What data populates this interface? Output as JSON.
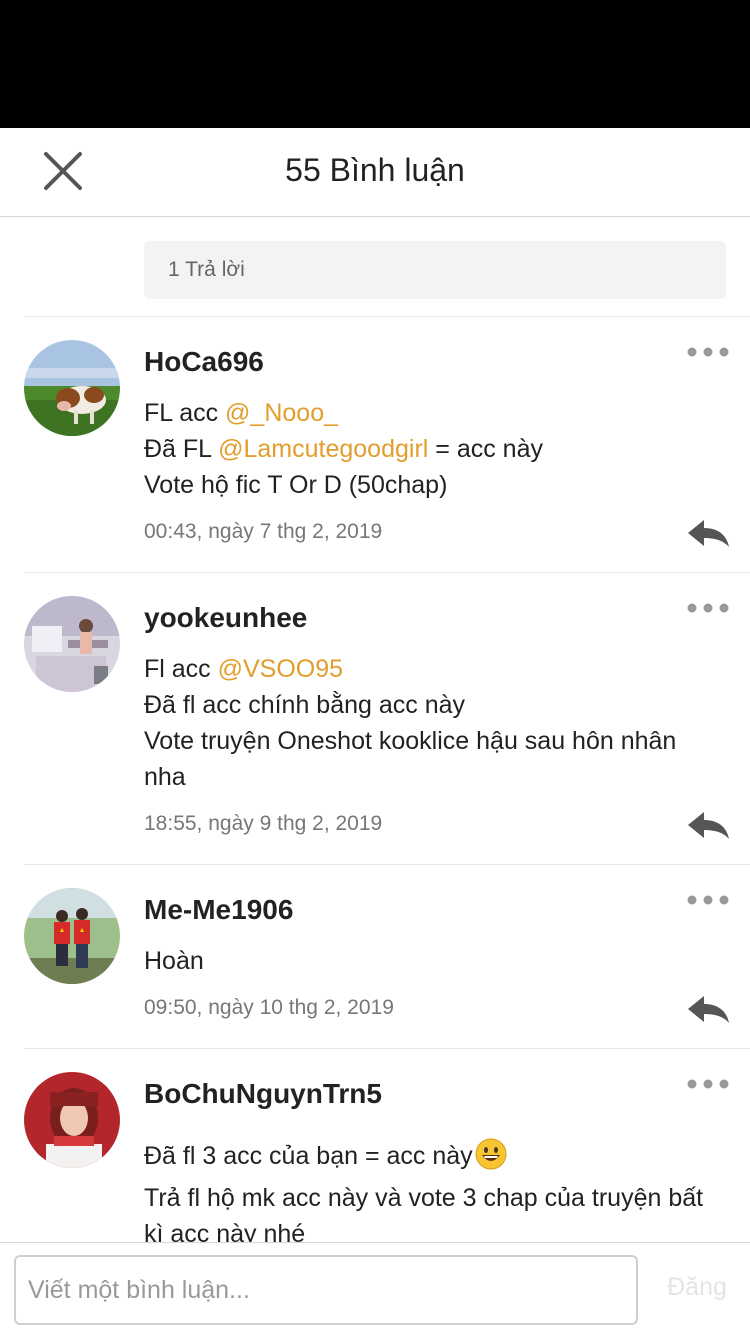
{
  "header": {
    "title": "55 Bình luận"
  },
  "reply_summary": "1 Trả lời",
  "accent_color": "#e29e2c",
  "comments": [
    {
      "username": "HoCa696",
      "avatar": "cow-in-field",
      "lines": [
        [
          {
            "text": "FL acc "
          },
          {
            "text": "@_Nooo_",
            "mention": true
          }
        ],
        [
          {
            "text": "Đã FL "
          },
          {
            "text": "@Lamcutegoodgirl",
            "mention": true
          },
          {
            "text": " = acc này"
          }
        ],
        [
          {
            "text": "Vote hộ fic T Or D (50chap)"
          }
        ]
      ],
      "timestamp": "00:43, ngày 7 thg 2, 2019"
    },
    {
      "username": "yookeunhee",
      "avatar": "room-interior",
      "lines": [
        [
          {
            "text": "Fl acc "
          },
          {
            "text": "@VSOO95",
            "mention": true
          }
        ],
        [
          {
            "text": "Đã fl acc chính bằng acc này"
          }
        ],
        [
          {
            "text": "Vote truyện Oneshot kooklice hậu sau hôn nhân"
          }
        ],
        [
          {
            "text": "nha"
          }
        ]
      ],
      "timestamp": "18:55, ngày 9 thg 2, 2019"
    },
    {
      "username": "Me-Me1906",
      "avatar": "two-people-red-shirts",
      "lines": [
        [
          {
            "text": "Hoàn"
          }
        ]
      ],
      "timestamp": "09:50, ngày 10 thg 2, 2019"
    },
    {
      "username": "BoChuNguynTrn5",
      "avatar": "girl-portrait",
      "lines": [
        [
          {
            "text": "Đã fl 3 acc của bạn = acc này"
          },
          {
            "emoji": "😀"
          }
        ],
        [
          {
            "text": "Trả fl hộ mk acc này và vote 3 chap của truyện bất"
          }
        ],
        [
          {
            "text": "kì acc này nhé"
          }
        ]
      ],
      "timestamp": ""
    }
  ],
  "footer": {
    "input_placeholder": "Viết một bình luận...",
    "post_label": "Đăng"
  }
}
